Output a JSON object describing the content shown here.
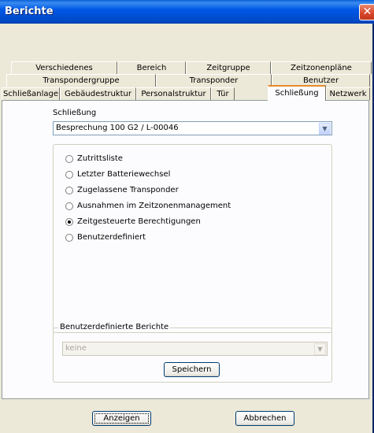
{
  "window": {
    "title": "Berichte",
    "close_glyph": "✕"
  },
  "tabs": {
    "row1": [
      "Verschiedenes",
      "Bereich",
      "Zeitgruppe",
      "Zeitzonenpläne"
    ],
    "row2": [
      "Transpondergruppe",
      "Transponder",
      "Benutzer"
    ],
    "row3": [
      "Schließanlage",
      "Gebäudestruktur",
      "Personalstruktur",
      "Tür",
      "Schließung",
      "Netzwerk"
    ],
    "active": "Schließung"
  },
  "schliessung": {
    "label": "Schließung",
    "selected": "Besprechung 100 G2 / L-00046",
    "dropdown_icon": "chevron-down-icon"
  },
  "options": {
    "items": [
      "Zutrittsliste",
      "Letzter Batteriewechsel",
      "Zugelassene Transponder",
      "Ausnahmen im Zeitzonenmanagement",
      "Zeitgesteuerte Berechtigungen",
      "Benutzerdefiniert"
    ],
    "selected_index": 4
  },
  "custom_reports": {
    "legend": "Benutzerdefinierte Berichte",
    "selected": "keine",
    "save_label": "Speichern"
  },
  "footer": {
    "show_label": "Anzeigen",
    "cancel_label": "Abbrechen"
  },
  "colors": {
    "titlebar": "#0058e6",
    "active_tab_accent": "#e68b2c",
    "dialog_bg": "#ece9d8"
  }
}
